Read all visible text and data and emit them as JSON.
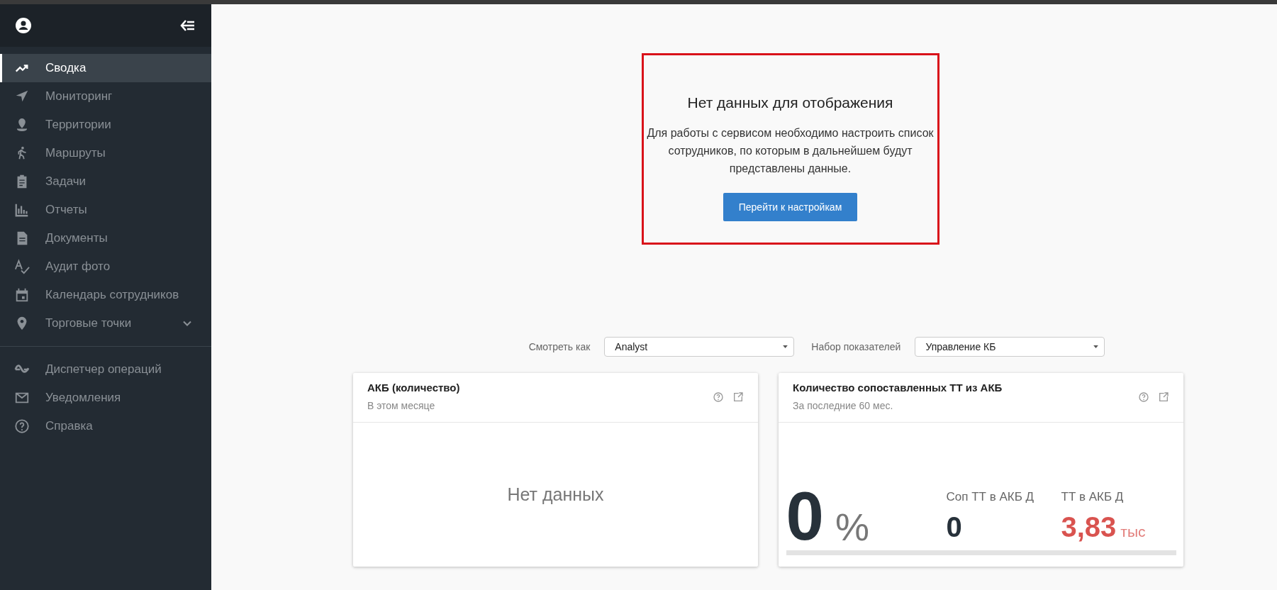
{
  "sidebar": {
    "sections": [
      {
        "items": [
          {
            "label": "Сводка",
            "selected": true
          },
          {
            "label": "Мониторинг",
            "selected": false
          },
          {
            "label": "Территории",
            "selected": false
          },
          {
            "label": "Маршруты",
            "selected": false
          },
          {
            "label": "Задачи",
            "selected": false
          },
          {
            "label": "Отчеты",
            "selected": false
          },
          {
            "label": "Документы",
            "selected": false
          },
          {
            "label": "Аудит фото",
            "selected": false
          },
          {
            "label": "Календарь сотрудников",
            "selected": false
          },
          {
            "label": "Торговые точки",
            "selected": false,
            "expanded": false
          }
        ]
      },
      {
        "items": [
          {
            "label": "Диспетчер операций",
            "selected": false
          },
          {
            "label": "Уведомления",
            "selected": false
          },
          {
            "label": "Справка",
            "selected": false
          }
        ]
      }
    ]
  },
  "empty_state": {
    "title": "Нет данных для отображения",
    "message": "Для работы с сервисом необходимо настроить список сотрудников, по которым в дальнейшем будут представлены данные.",
    "button": "Перейти к настройкам"
  },
  "filters": [
    {
      "label": "Смотреть как",
      "value": "Analyst"
    },
    {
      "label": "Набор показателей",
      "value": "Управление КБ"
    }
  ],
  "cards": [
    {
      "kind": "empty",
      "title": "АКБ (количество)",
      "subtitle": "В этом месяце",
      "message": "Нет данных"
    },
    {
      "kind": "ratio",
      "title": "Количество сопоставленных ТТ из АКБ",
      "subtitle": "За последние 60 мес.",
      "value": "0",
      "unit": "%",
      "level": 0,
      "stats": [
        {
          "label": "Соп ТТ в АКБ Д",
          "value": "0",
          "color": "#27313a"
        },
        {
          "label": "ТТ в АКБ Д",
          "value": "3,83",
          "unit": "тыс",
          "color": "#d9534f"
        }
      ]
    }
  ]
}
